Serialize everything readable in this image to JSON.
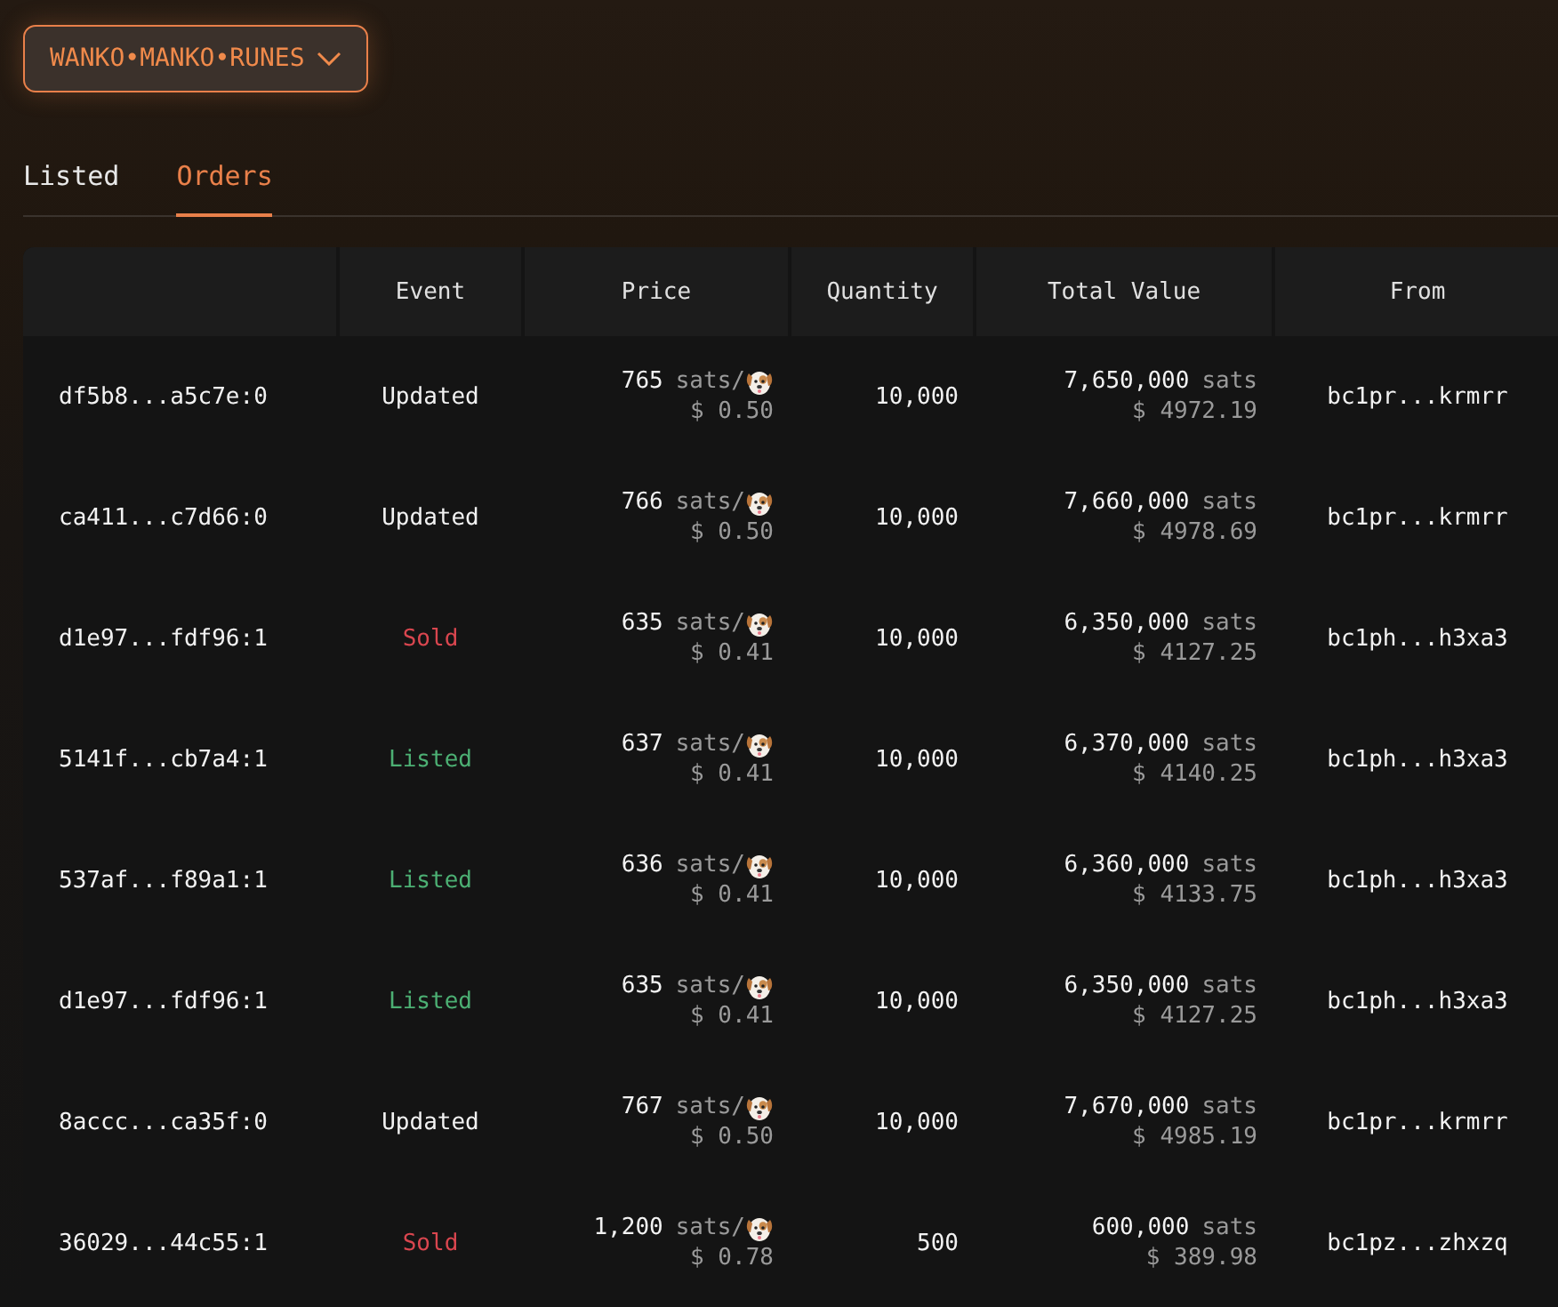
{
  "collection_selector": {
    "label": "WANKO•MANKO•RUNES"
  },
  "tabs": [
    {
      "label": "Listed",
      "selected": false
    },
    {
      "label": "Orders",
      "selected": true
    }
  ],
  "table": {
    "columns": [
      "Event",
      "Price",
      "Quantity",
      "Total Value",
      "From"
    ],
    "rows": [
      {
        "output": "df5b8...a5c7e:0",
        "event": "Updated",
        "kind": "updated",
        "price": "765",
        "price_unit": "sats/",
        "price_usd": "$ 0.50",
        "quantity": "10,000",
        "total": "7,650,000",
        "total_unit": "sats",
        "total_usd": "$ 4972.19",
        "from": "bc1pr...krmrr"
      },
      {
        "output": "ca411...c7d66:0",
        "event": "Updated",
        "kind": "updated",
        "price": "766",
        "price_unit": "sats/",
        "price_usd": "$ 0.50",
        "quantity": "10,000",
        "total": "7,660,000",
        "total_unit": "sats",
        "total_usd": "$ 4978.69",
        "from": "bc1pr...krmrr"
      },
      {
        "output": "d1e97...fdf96:1",
        "event": "Sold",
        "kind": "sold",
        "price": "635",
        "price_unit": "sats/",
        "price_usd": "$ 0.41",
        "quantity": "10,000",
        "total": "6,350,000",
        "total_unit": "sats",
        "total_usd": "$ 4127.25",
        "from": "bc1ph...h3xa3"
      },
      {
        "output": "5141f...cb7a4:1",
        "event": "Listed",
        "kind": "listed",
        "price": "637",
        "price_unit": "sats/",
        "price_usd": "$ 0.41",
        "quantity": "10,000",
        "total": "6,370,000",
        "total_unit": "sats",
        "total_usd": "$ 4140.25",
        "from": "bc1ph...h3xa3"
      },
      {
        "output": "537af...f89a1:1",
        "event": "Listed",
        "kind": "listed",
        "price": "636",
        "price_unit": "sats/",
        "price_usd": "$ 0.41",
        "quantity": "10,000",
        "total": "6,360,000",
        "total_unit": "sats",
        "total_usd": "$ 4133.75",
        "from": "bc1ph...h3xa3"
      },
      {
        "output": "d1e97...fdf96:1",
        "event": "Listed",
        "kind": "listed",
        "price": "635",
        "price_unit": "sats/",
        "price_usd": "$ 0.41",
        "quantity": "10,000",
        "total": "6,350,000",
        "total_unit": "sats",
        "total_usd": "$ 4127.25",
        "from": "bc1ph...h3xa3"
      },
      {
        "output": "8accc...ca35f:0",
        "event": "Updated",
        "kind": "updated",
        "price": "767",
        "price_unit": "sats/",
        "price_usd": "$ 0.50",
        "quantity": "10,000",
        "total": "7,670,000",
        "total_unit": "sats",
        "total_usd": "$ 4985.19",
        "from": "bc1pr...krmrr"
      },
      {
        "output": "36029...44c55:1",
        "event": "Sold",
        "kind": "sold",
        "price": "1,200",
        "price_unit": "sats/",
        "price_usd": "$ 0.78",
        "quantity": "500",
        "total": "600,000",
        "total_unit": "sats",
        "total_usd": "$ 389.98",
        "from": "bc1pz...zhxzq"
      }
    ]
  }
}
